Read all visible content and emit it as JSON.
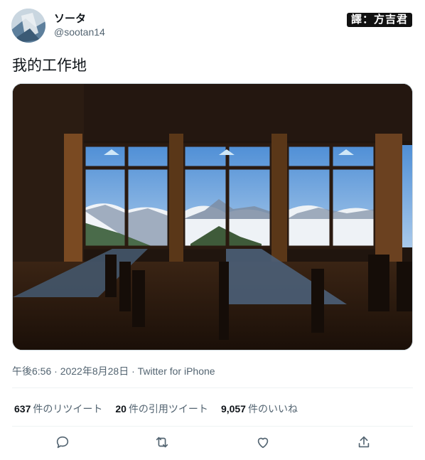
{
  "author": {
    "display_name": "ソータ",
    "handle": "@sootan14"
  },
  "watermark": "譯：方吉君",
  "tweet": {
    "text": "我的工作地",
    "image_description_icon": "photo",
    "meta": "午後6:56 · 2022年8月28日 · Twitter for iPhone"
  },
  "stats": {
    "retweets_count": "637",
    "retweets_label": "件のリツイート",
    "quotes_count": "20",
    "quotes_label": "件の引用ツイート",
    "likes_count": "9,057",
    "likes_label": "件のいいね"
  },
  "actions": {
    "reply_icon": "reply-icon",
    "retweet_icon": "retweet-icon",
    "like_icon": "heart-icon",
    "share_icon": "share-icon"
  }
}
